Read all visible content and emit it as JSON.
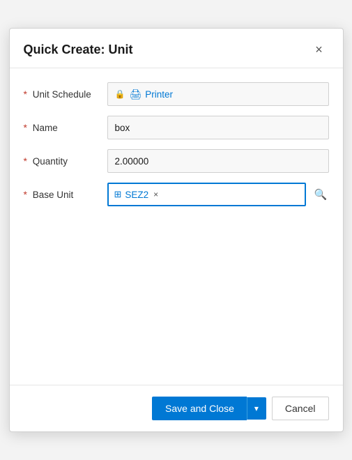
{
  "dialog": {
    "title": "Quick Create: Unit",
    "close_label": "×"
  },
  "form": {
    "unit_schedule": {
      "label": "Unit Schedule",
      "required": true,
      "locked": true,
      "value_text": "Printer",
      "printer_icon": "🖨"
    },
    "name": {
      "label": "Name",
      "required": true,
      "value": "box",
      "placeholder": ""
    },
    "quantity": {
      "label": "Quantity",
      "required": true,
      "value": "2.00000",
      "placeholder": ""
    },
    "base_unit": {
      "label": "Base Unit",
      "required": true,
      "tag_text": "SEZ2",
      "unit_icon": "⊞",
      "close_label": "×",
      "search_icon": "🔍"
    }
  },
  "footer": {
    "save_close_label": "Save and Close",
    "dropdown_arrow": "▾",
    "cancel_label": "Cancel"
  }
}
